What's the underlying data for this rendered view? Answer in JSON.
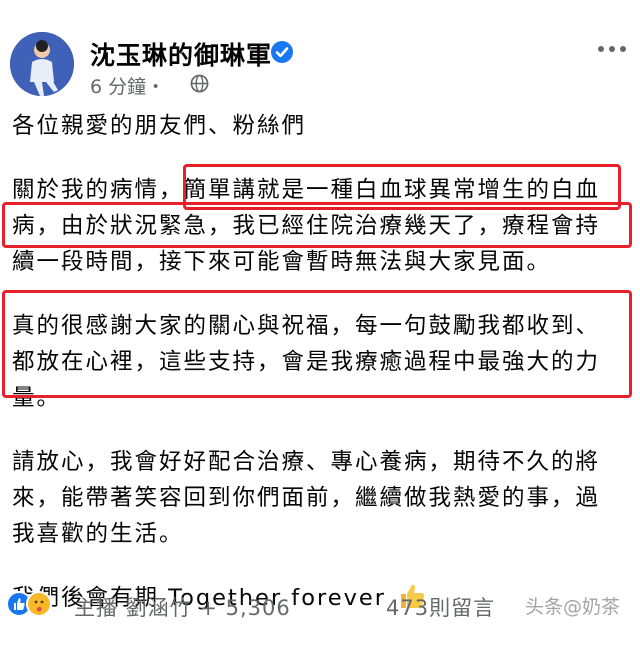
{
  "header": {
    "author": "沈玉琳的御琳軍",
    "timestamp": "6 分鐘・",
    "icons": {
      "verified": "verified-badge-icon",
      "privacy": "globe-icon",
      "more": "more-options-icon"
    }
  },
  "post": {
    "greeting": "各位親愛的朋友們、粉絲們",
    "para1": [
      "關於我的病情，簡單講就是一種白血球異常增生的白血",
      "病，由於狀況緊急，我已經住院治療幾天了，療程會持",
      "續一段時間，接下來可能會暫時無法與大家見面。"
    ],
    "para2": [
      "真的很感謝大家的關心與祝福，每一句鼓勵我都收到、",
      "都放在心裡，這些支持，會是我療癒過程中最強大的力",
      "量。"
    ],
    "para3": [
      "請放心，我會好好配合治療、專心養病，期待不久的將",
      "來，能帶著笑容回到你們面前，繼續做我熱愛的事，過",
      "我喜歡的生活。"
    ],
    "closing": "我們後會有期  Together forever",
    "closing_emoji": "thumbs-up-icon"
  },
  "footer": {
    "reactions_text": "主播 劉涵竹 + 5,306",
    "comments": "473則留言",
    "watermark": "头条@奶茶",
    "reaction_icons": [
      "like-reaction-icon",
      "care-reaction-icon"
    ]
  },
  "colors": {
    "highlight_box": "#e8202a",
    "verified": "#1877f2",
    "meta_text": "#65676b"
  }
}
